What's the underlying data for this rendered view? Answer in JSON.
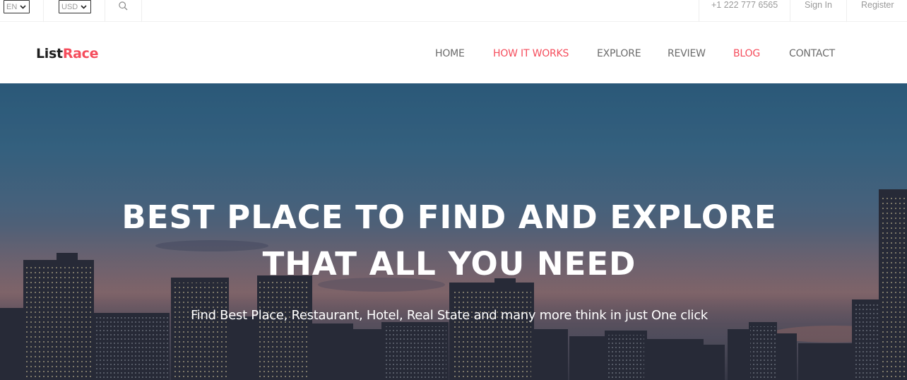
{
  "topbar": {
    "language": "EN",
    "currency": "USD",
    "phone": "+1 222 777 6565",
    "sign_in": "Sign In",
    "register": "Register"
  },
  "header": {
    "logo_part1": "List",
    "logo_part2": "Race",
    "nav": [
      "HOME",
      "HOW IT WORKS",
      "EXPLORE",
      "REVIEW",
      "BLOG",
      "CONTACT"
    ]
  },
  "hero": {
    "title_line1": "BEST PLACE TO FIND AND EXPLORE",
    "title_line2": "THAT ALL YOU NEED",
    "subtitle": "Find Best Place, Restaurant, Hotel, Real State and many more think in just One click"
  },
  "colors": {
    "accent": "#f54d5c",
    "nav_text": "#6b6b6b",
    "topbar_text": "#9a9a9a"
  },
  "icons": {
    "search": "search-icon",
    "dropdown": "chevron-down-icon"
  }
}
